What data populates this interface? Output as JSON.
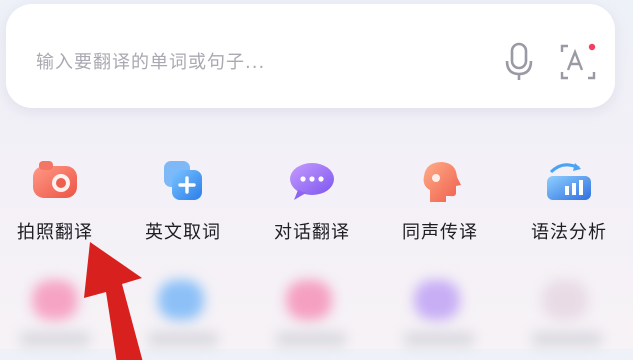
{
  "search": {
    "placeholder": "输入要翻译的单词或句子...",
    "voice_icon": "microphone-icon",
    "scan_icon": "camera-text-recognition-icon"
  },
  "tools": [
    {
      "label": "拍照翻译",
      "icon": "camera-icon",
      "color": "#f06a5a"
    },
    {
      "label": "英文取词",
      "icon": "word-pick-icon",
      "color": "#3b8ef0"
    },
    {
      "label": "对话翻译",
      "icon": "chat-bubble-icon",
      "color": "#8b6cf0"
    },
    {
      "label": "同声传译",
      "icon": "head-profile-icon",
      "color": "#f07a5a"
    },
    {
      "label": "语法分析",
      "icon": "grammar-chart-icon",
      "color": "#3a7be8"
    }
  ],
  "annotation": {
    "arrow_color": "#d8201e"
  }
}
